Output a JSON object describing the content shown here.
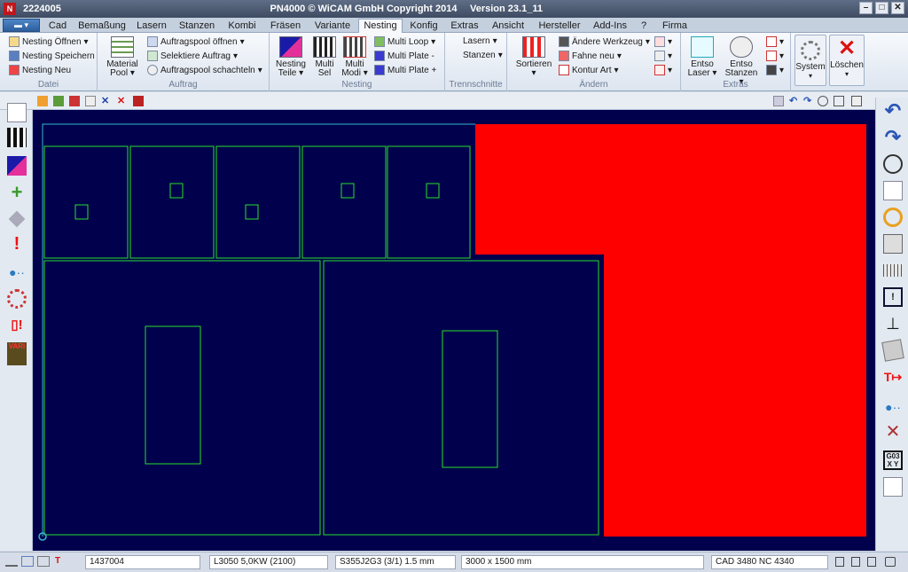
{
  "titlebar": {
    "job": "2224005",
    "app": "PN4000 © WiCAM GmbH Copyright 2014",
    "version": "Version 23.1_11",
    "logo": "N"
  },
  "tabs": [
    "Cad",
    "Bemaßung",
    "Lasern",
    "Stanzen",
    "Kombi",
    "Fräsen",
    "Variante",
    "Nesting",
    "Konfig",
    "Extras",
    "Ansicht",
    "Hersteller",
    "Add-Ins",
    "?",
    "Firma"
  ],
  "active_tab": "Nesting",
  "ribbon": {
    "datei": {
      "label": "Datei",
      "open": "Nesting Öffnen",
      "save": "Nesting Speichern",
      "new": "Nesting Neu"
    },
    "auftrag": {
      "label": "Auftrag",
      "material1": "Material",
      "material2": "Pool",
      "pool_open": "Auftragspool öffnen",
      "select": "Selektiere Auftrag",
      "schachteln": "Auftragspool schachteln"
    },
    "nesting": {
      "label": "Nesting",
      "teile1": "Nesting",
      "teile2": "Teile",
      "multisel1": "Multi",
      "multisel2": "Sel",
      "multimodi1": "Multi",
      "multimodi2": "Modi",
      "loop": "Multi Loop",
      "plate_minus": "Multi Plate -",
      "plate_plus": "Multi Plate +"
    },
    "trenn": {
      "label": "Trennschnitte",
      "lasern": "Lasern",
      "stanzen": "Stanzen"
    },
    "aendern": {
      "label": "Ändern",
      "sortieren": "Sortieren",
      "werkzeug": "Ändere Werkzeug",
      "fahne": "Fahne neu",
      "kontur": "Kontur Art"
    },
    "extras": {
      "label": "Extras",
      "entso_laser1": "Entso",
      "entso_laser2": "Laser",
      "entso_stanzen1": "Entso",
      "entso_stanzen2": "Stanzen"
    },
    "system": "System",
    "loeschen": "Löschen"
  },
  "status": {
    "f1": "1437004",
    "f2": "L3050  5,0KW    (2100)",
    "f3": "S355J2G3    (3/1)     1.5 mm",
    "f4": "3000 x 1500 mm",
    "f5": "CAD 3480    NC 4340"
  },
  "colors": {
    "canvas": "#00004c",
    "part": "#27e02a",
    "scrap": "#ff0000",
    "sheet_edge": "#39b6d0"
  }
}
